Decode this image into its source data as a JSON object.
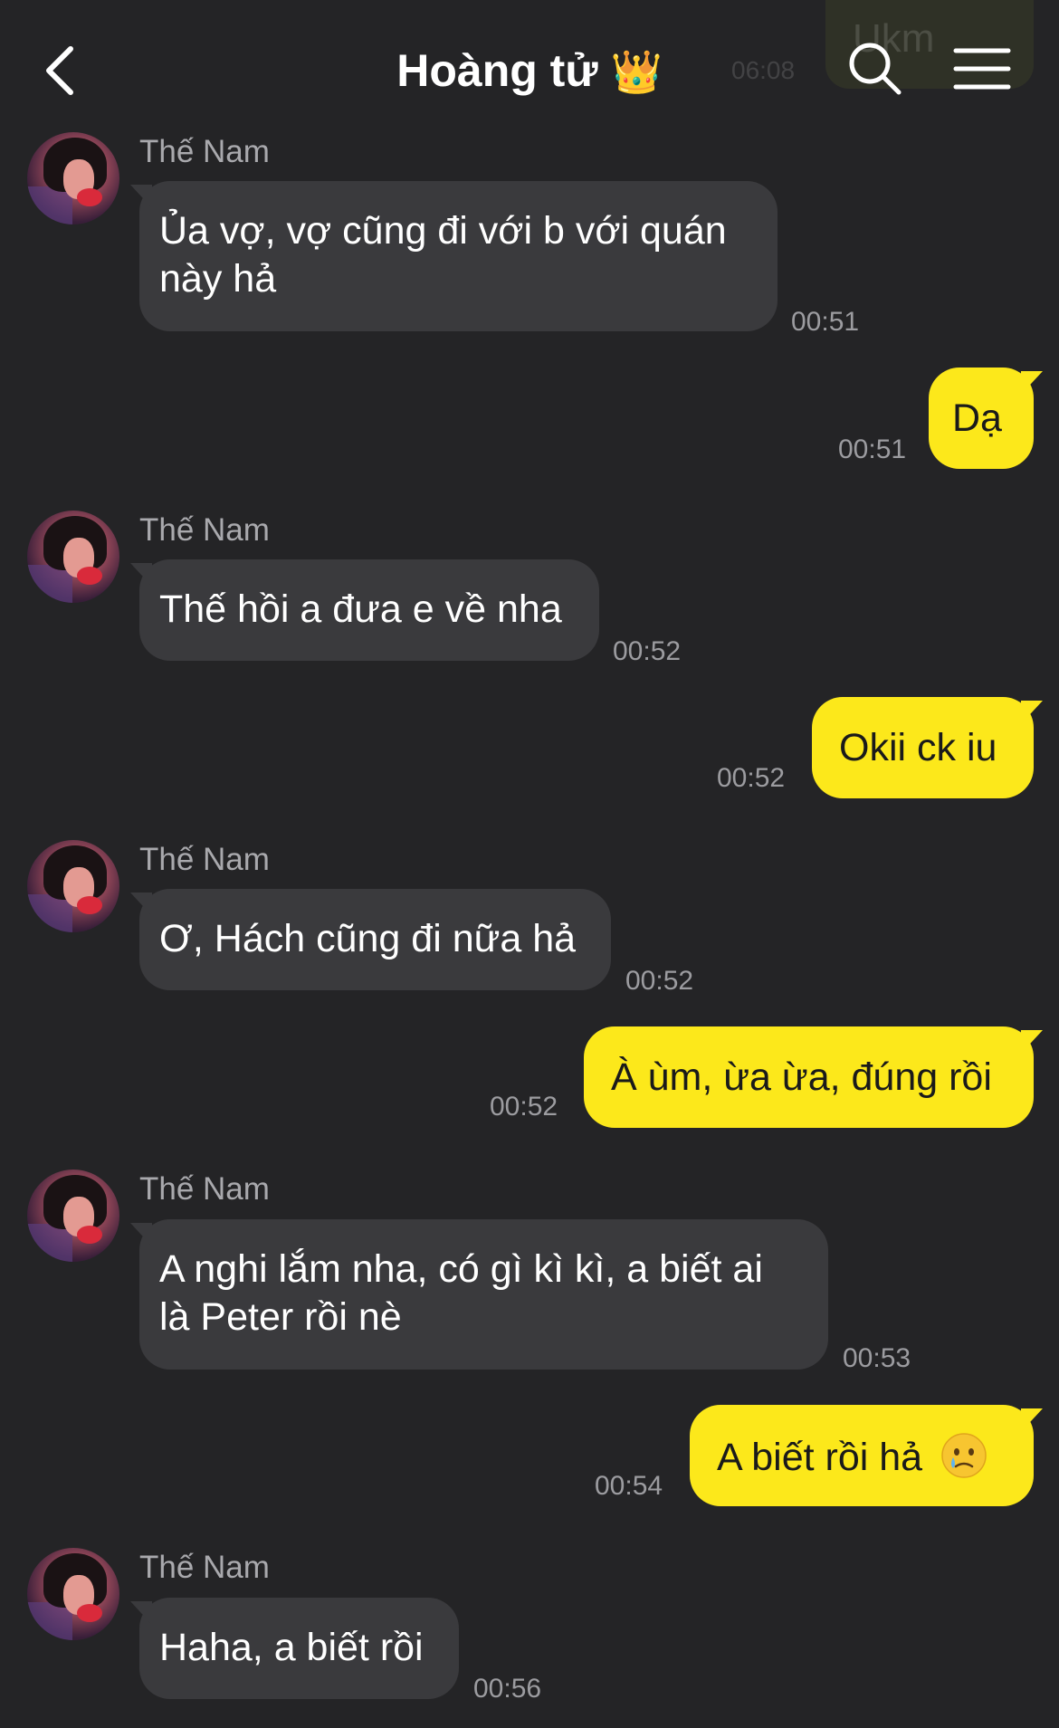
{
  "header": {
    "title": "Hoàng tử",
    "title_emoji": "👑"
  },
  "colors": {
    "background": "#242426",
    "incoming_bubble": "#3a3a3d",
    "outgoing_bubble": "#fce81b",
    "timestamp": "#9c9ca0"
  },
  "faded_message": {
    "text": "Ukm",
    "time": "06:08"
  },
  "messages": [
    {
      "from": "Thế Nam",
      "text_line1": "Ủa vợ, vợ cũng đi với b với quán",
      "text_line2": "này hả",
      "time": "00:51"
    },
    {
      "from": "me",
      "text": "Dạ",
      "time": "00:51"
    },
    {
      "from": "Thế Nam",
      "text": "Thế hồi a đưa e về nha",
      "time": "00:52"
    },
    {
      "from": "me",
      "text": "Okii ck iu",
      "time": "00:52"
    },
    {
      "from": "Thế Nam",
      "text": "Ơ, Hách cũng đi nữa hả",
      "time": "00:52"
    },
    {
      "from": "me",
      "text": "À ùm, ừa ừa, đúng rồi",
      "time": "00:52"
    },
    {
      "from": "Thế Nam",
      "text_line1": "A nghi lắm nha, có gì kì kì, a biết ai",
      "text_line2": "là Peter rồi nè",
      "time": "00:53"
    },
    {
      "from": "me",
      "text": "A biết rồi hả",
      "emoji": "crying-face",
      "time": "00:54"
    },
    {
      "from": "Thế Nam",
      "text": "Haha, a biết rồi",
      "time": "00:56"
    }
  ]
}
